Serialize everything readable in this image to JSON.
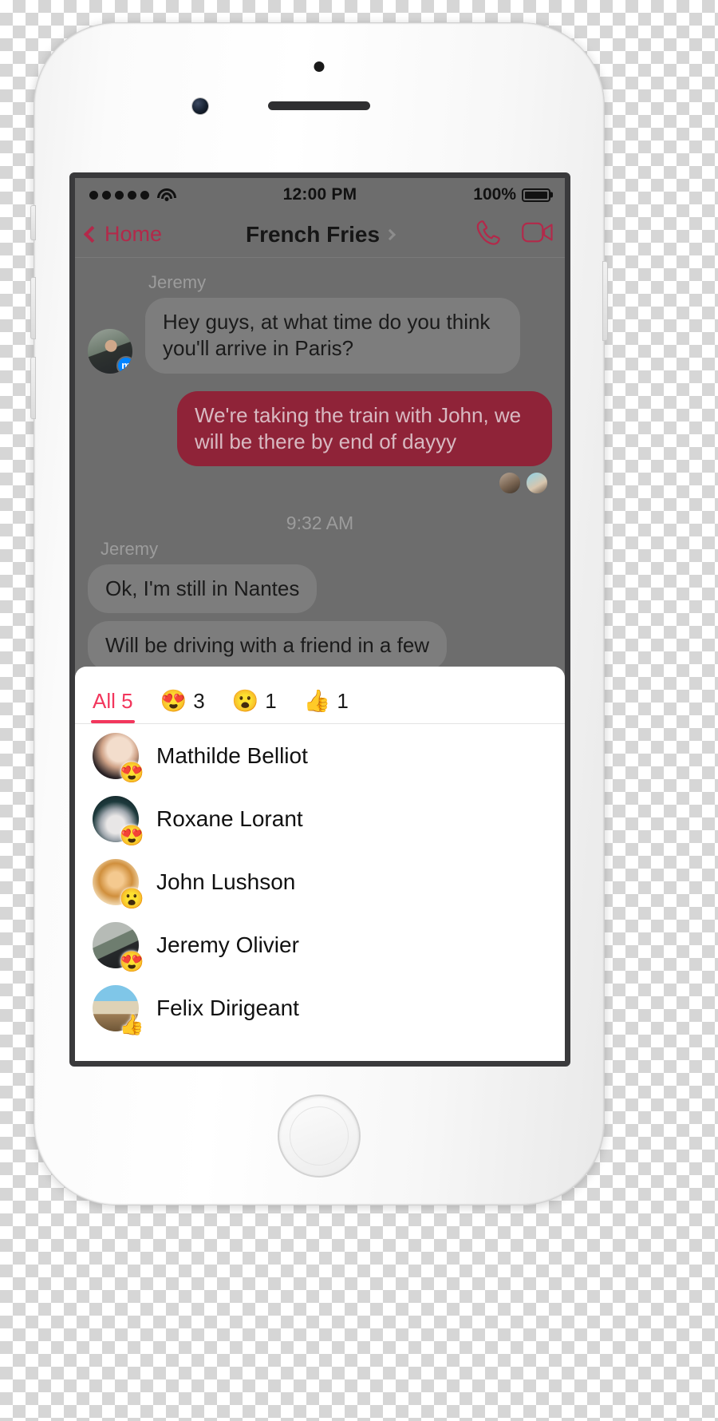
{
  "status_bar": {
    "signal_dots": 5,
    "wifi_icon": "wifi-icon",
    "time": "12:00 PM",
    "battery_percent": "100%",
    "battery_icon": "battery-full-icon"
  },
  "nav_bar": {
    "back_label": "Home",
    "back_icon": "chevron-left-icon",
    "title": "French Fries",
    "title_chevron_icon": "chevron-right-icon",
    "call_icon": "phone-icon",
    "video_icon": "video-camera-icon",
    "accent_color": "#b3294a"
  },
  "thread": {
    "groups": [
      {
        "sender": "Jeremy",
        "avatar_name": "avatar-jeremy",
        "badge_icon": "messenger-badge-icon",
        "messages": [
          {
            "text": "Hey guys, at what time do you think you'll arrive in Paris?",
            "direction": "in"
          }
        ]
      },
      {
        "sender": "",
        "messages": [
          {
            "text": "We're taking the train with John, we will be there by end of dayyy",
            "direction": "out"
          }
        ],
        "reactor_thumbs": [
          "reactor-thumb-1",
          "reactor-thumb-2"
        ]
      }
    ],
    "timestamp": "9:32 AM",
    "second_group": {
      "sender": "Jeremy",
      "messages": [
        {
          "text": "Ok, I'm still in Nantes",
          "direction": "in"
        },
        {
          "text": "Will be driving with a friend in a few",
          "direction": "in"
        }
      ]
    }
  },
  "reaction_sheet": {
    "tabs": [
      {
        "label": "All 5",
        "emoji": "",
        "count": "",
        "active": true,
        "name": "tab-all"
      },
      {
        "label": "",
        "emoji": "😍",
        "count": "3",
        "active": false,
        "name": "tab-love"
      },
      {
        "label": "",
        "emoji": "😮",
        "count": "1",
        "active": false,
        "name": "tab-wow"
      },
      {
        "label": "",
        "emoji": "👍",
        "count": "1",
        "active": false,
        "name": "tab-like"
      }
    ],
    "active_tab_color": "#f2365c",
    "reactors": [
      {
        "name": "Mathilde Belliot",
        "emoji": "😍",
        "avatar_class": "av-mathilde"
      },
      {
        "name": "Roxane Lorant",
        "emoji": "😍",
        "avatar_class": "av-roxane"
      },
      {
        "name": "John Lushson",
        "emoji": "😮",
        "avatar_class": "av-john"
      },
      {
        "name": "Jeremy Olivier",
        "emoji": "😍",
        "avatar_class": "av-jeremy"
      },
      {
        "name": "Felix Dirigeant",
        "emoji": "👍",
        "avatar_class": "av-felix"
      }
    ]
  }
}
